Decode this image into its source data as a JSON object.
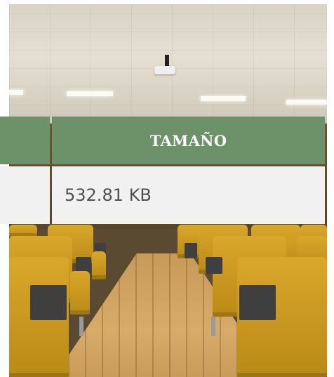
{
  "table": {
    "headers": [
      "",
      "TAMAÑO"
    ],
    "rows": [
      [
        "",
        "532.81 KB"
      ]
    ]
  },
  "colors": {
    "header_bg": "#6d9168",
    "header_text": "#ffffff",
    "row_bg": "#f1f1f1",
    "row_text": "#505050"
  }
}
